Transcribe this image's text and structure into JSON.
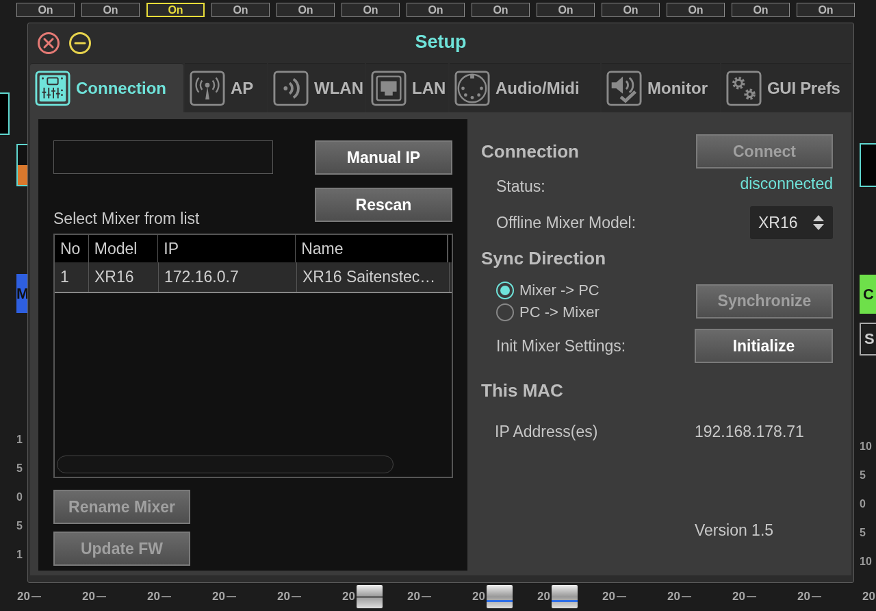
{
  "mixer": {
    "on_buttons": [
      {
        "label": "On",
        "selected": false
      },
      {
        "label": "On",
        "selected": false
      },
      {
        "label": "On",
        "selected": true
      },
      {
        "label": "On",
        "selected": false
      },
      {
        "label": "On",
        "selected": false
      },
      {
        "label": "On",
        "selected": false
      },
      {
        "label": "On",
        "selected": false
      },
      {
        "label": "On",
        "selected": false
      },
      {
        "label": "On",
        "selected": false
      },
      {
        "label": "On",
        "selected": false
      },
      {
        "label": "On",
        "selected": false
      },
      {
        "label": "On",
        "selected": false
      },
      {
        "label": "On",
        "selected": false
      }
    ],
    "left_strip": {
      "button_label": "M",
      "scale": [
        "1",
        "5",
        "0",
        "5",
        "1"
      ]
    },
    "right_strip": {
      "buttons": [
        {
          "label": "C",
          "kind": "lit"
        },
        {
          "label": "S",
          "kind": "plain"
        }
      ],
      "scale": [
        "10",
        "5",
        "0",
        "5",
        "10"
      ]
    },
    "bottom_strips": [
      {
        "label": "20",
        "kind": "tick"
      },
      {
        "label": "20",
        "kind": "tick"
      },
      {
        "label": "20",
        "kind": "tick"
      },
      {
        "label": "20",
        "kind": "tick"
      },
      {
        "label": "20",
        "kind": "tick"
      },
      {
        "label": "20",
        "kind": "knob"
      },
      {
        "label": "20",
        "kind": "tick"
      },
      {
        "label": "20",
        "kind": "blueknob"
      },
      {
        "label": "20",
        "kind": "blueknob"
      },
      {
        "label": "20",
        "kind": "tick"
      },
      {
        "label": "20",
        "kind": "tick"
      },
      {
        "label": "20",
        "kind": "tick"
      },
      {
        "label": "20",
        "kind": "tick"
      },
      {
        "label": "20",
        "kind": "tick"
      }
    ]
  },
  "window": {
    "title": "Setup"
  },
  "tabs": [
    {
      "label": "Connection",
      "kind": "mixer",
      "selected": true
    },
    {
      "label": "AP",
      "kind": "antenna",
      "selected": false
    },
    {
      "label": "WLAN",
      "kind": "wave",
      "selected": false
    },
    {
      "label": "LAN",
      "kind": "port",
      "selected": false
    },
    {
      "label": "Audio/Midi",
      "kind": "midi",
      "selected": false
    },
    {
      "label": "Monitor",
      "kind": "speaker",
      "selected": false
    },
    {
      "label": "GUI Prefs",
      "kind": "gears",
      "selected": false
    }
  ],
  "mixer_list": {
    "buttons": [
      {
        "label": "Manual IP",
        "disabled": false
      },
      {
        "label": "Rescan",
        "disabled": false
      }
    ],
    "caption": "Select Mixer from list",
    "columns": [
      "No",
      "Model",
      "IP",
      "Name"
    ],
    "rows": [
      [
        "1",
        "XR16",
        "172.16.0.7",
        "XR16 Saitenstec…"
      ]
    ],
    "bottom_buttons": [
      {
        "label": "Rename Mixer",
        "disabled": true
      },
      {
        "label": "Update FW",
        "disabled": true
      }
    ]
  },
  "connection": {
    "heading": "Connection",
    "connect_button": {
      "label": "Connect",
      "disabled": true
    },
    "status_label": "Status:",
    "status_value": "disconnected",
    "model_label": "Offline Mixer Model:",
    "model_value": "XR16",
    "sync_heading": "Sync Direction",
    "sync_options": [
      {
        "label": "Mixer -> PC",
        "selected": true
      },
      {
        "label": "PC -> Mixer",
        "selected": false
      }
    ],
    "sync_button": {
      "label": "Synchronize",
      "disabled": true
    },
    "init_label": "Init Mixer Settings:",
    "init_button": {
      "label": "Initialize",
      "disabled": false
    },
    "mac_heading": "This MAC",
    "ip_label": "IP Address(es)",
    "ip_value": "192.168.178.71",
    "version": "Version 1.5"
  }
}
